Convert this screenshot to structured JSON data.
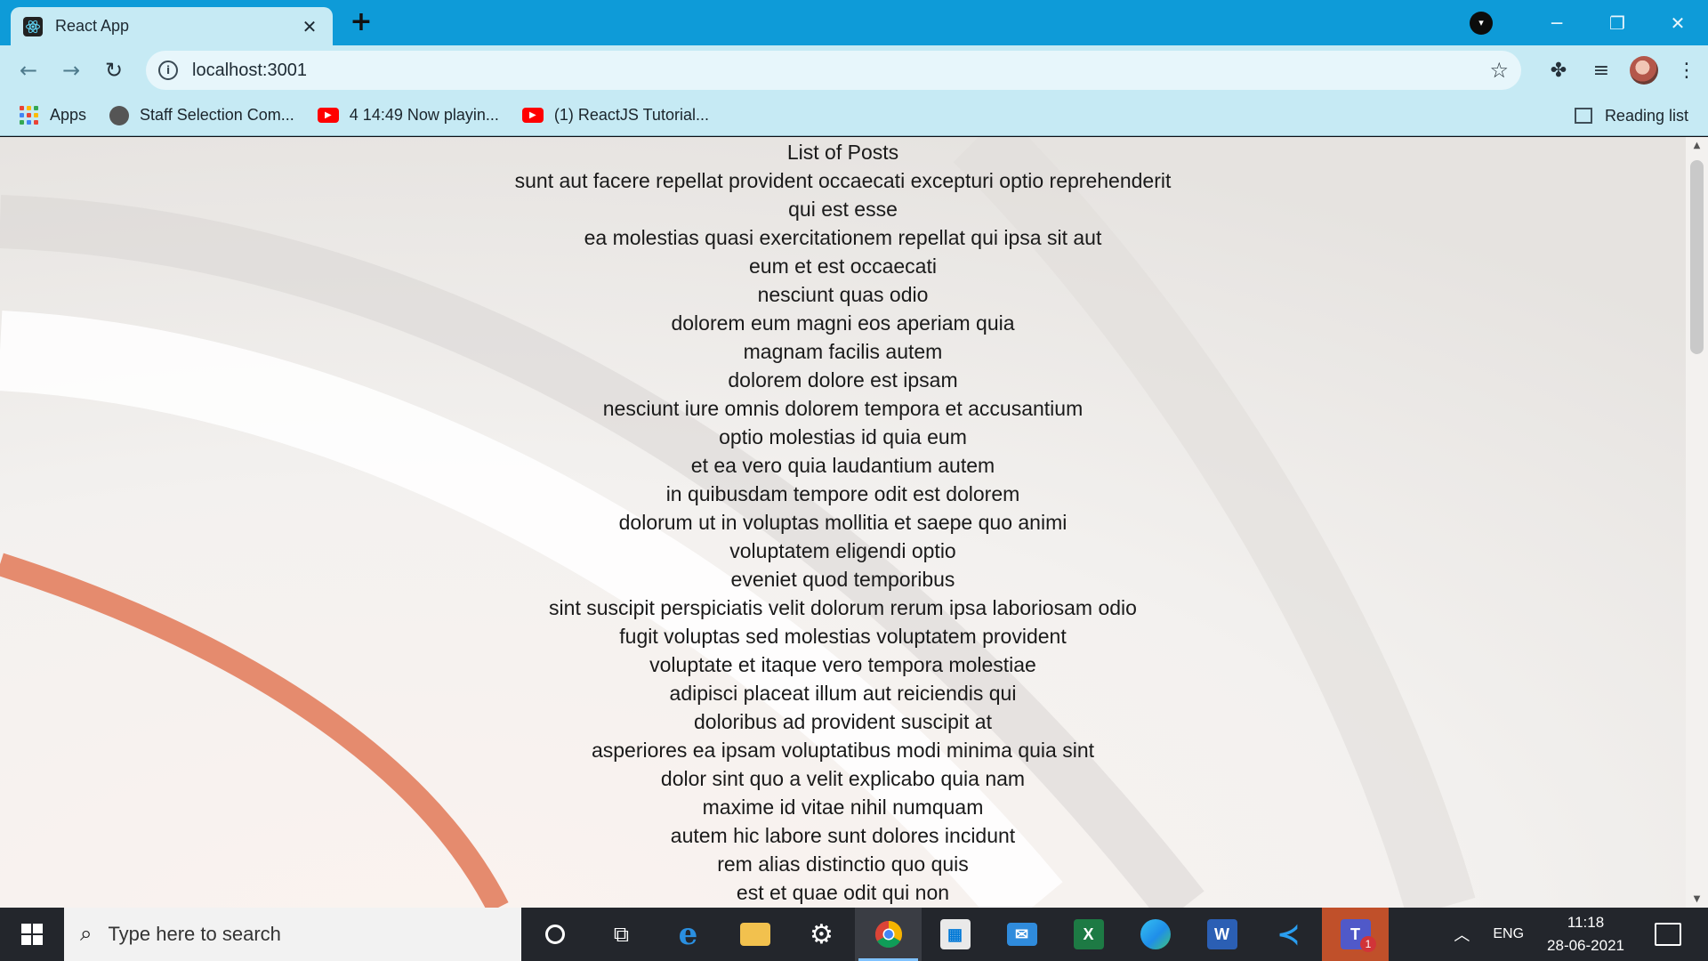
{
  "browser": {
    "tab_title": "React App",
    "tab_close_glyph": "✕",
    "new_tab_glyph": "+",
    "url": "localhost:3001",
    "bookmarks": [
      {
        "label": "Apps",
        "icon": "apps-grid-icon"
      },
      {
        "label": "Staff Selection Com...",
        "icon": "globe-icon"
      },
      {
        "label": "4 14:49 Now playin...",
        "icon": "youtube-icon"
      },
      {
        "label": "(1) ReactJS Tutorial...",
        "icon": "youtube-icon"
      }
    ],
    "reading_list": "Reading list"
  },
  "page": {
    "heading": "List of Posts",
    "posts": [
      "sunt aut facere repellat provident occaecati excepturi optio reprehenderit",
      "qui est esse",
      "ea molestias quasi exercitationem repellat qui ipsa sit aut",
      "eum et est occaecati",
      "nesciunt quas odio",
      "dolorem eum magni eos aperiam quia",
      "magnam facilis autem",
      "dolorem dolore est ipsam",
      "nesciunt iure omnis dolorem tempora et accusantium",
      "optio molestias id quia eum",
      "et ea vero quia laudantium autem",
      "in quibusdam tempore odit est dolorem",
      "dolorum ut in voluptas mollitia et saepe quo animi",
      "voluptatem eligendi optio",
      "eveniet quod temporibus",
      "sint suscipit perspiciatis velit dolorum rerum ipsa laboriosam odio",
      "fugit voluptas sed molestias voluptatem provident",
      "voluptate et itaque vero tempora molestiae",
      "adipisci placeat illum aut reiciendis qui",
      "doloribus ad provident suscipit at",
      "asperiores ea ipsam voluptatibus modi minima quia sint",
      "dolor sint quo a velit explicabo quia nam",
      "maxime id vitae nihil numquam",
      "autem hic labore sunt dolores incidunt",
      "rem alias distinctio quo quis",
      "est et quae odit qui non"
    ]
  },
  "taskbar": {
    "search_placeholder": "Type here to search",
    "language": "ENG",
    "time": "11:18",
    "date": "28-06-2021",
    "teams_badge": "1",
    "apps": [
      "cortana-icon",
      "task-view-icon",
      "edge-legacy-icon",
      "file-explorer-icon",
      "settings-icon",
      "chrome-icon",
      "store-icon",
      "mail-icon",
      "excel-icon",
      "edge-icon",
      "word-icon",
      "vscode-icon",
      "teams-icon"
    ]
  },
  "colors": {
    "titlebar": "#0e9bd8",
    "toolbar": "#c6eaf4",
    "taskbar": "#23262c",
    "wallpaper_accent": "#e58b6e"
  }
}
